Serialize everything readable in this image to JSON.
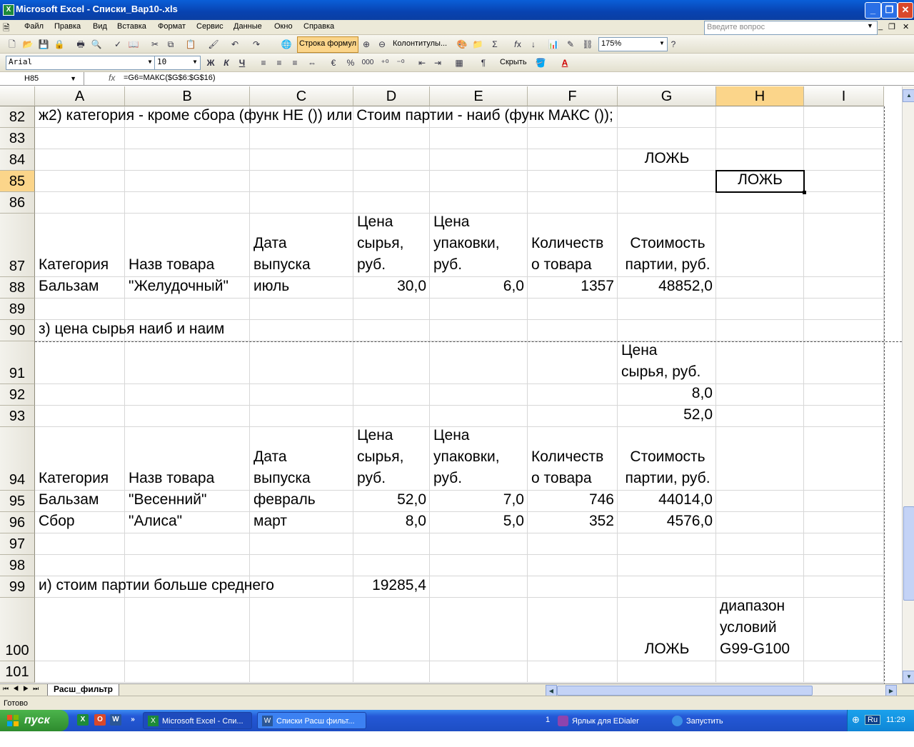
{
  "window": {
    "title": "Microsoft Excel - Списки_Вар10-.xls",
    "help_placeholder": "Введите вопрос"
  },
  "menu": [
    "Файл",
    "Правка",
    "Вид",
    "Вставка",
    "Формат",
    "Сервис",
    "Данные",
    "Окно",
    "Справка"
  ],
  "toolbar": {
    "formula_bar_btn": "Строка формул",
    "headers_footers_btn": "Колонтитулы...",
    "zoom": "175%",
    "font": "Arial",
    "font_size": "10",
    "bold": "Ж",
    "italic": "К",
    "underline": "Ч",
    "percent": "%",
    "thousands": "000",
    "wrap_text": "Скрыть"
  },
  "formula_bar": {
    "name_box": "H85",
    "fx": "fx",
    "formula": "=G6=МАКС($G$6:$G$16)"
  },
  "columns": [
    "A",
    "B",
    "C",
    "D",
    "E",
    "F",
    "G",
    "H",
    "I"
  ],
  "rows": [
    "82",
    "83",
    "84",
    "85",
    "86",
    "87",
    "88",
    "89",
    "90",
    "91",
    "92",
    "93",
    "94",
    "95",
    "96",
    "97",
    "98",
    "99",
    "100",
    "101"
  ],
  "cells": {
    "r82": {
      "A": "ж2) категория - кроме сбора (функ НЕ ()) или Стоим партии - наиб (функ МАКС ());"
    },
    "r84": {
      "G": "ЛОЖЬ"
    },
    "r85": {
      "H": "ЛОЖЬ"
    },
    "r87": {
      "A": "Категория",
      "B": "Назв товара",
      "C": [
        "Дата",
        "выпуска"
      ],
      "D": [
        "Цена",
        "сырья,",
        "руб."
      ],
      "E": [
        "Цена",
        "упаковки,",
        "руб."
      ],
      "F": [
        "Количеств",
        "о товара"
      ],
      "G": [
        "Стоимость",
        "партии, руб."
      ]
    },
    "r88": {
      "A": "Бальзам",
      "B": "\"Желудочный\"",
      "C": "июль",
      "D": "30,0",
      "E": "6,0",
      "F": "1357",
      "G": "48852,0"
    },
    "r90": {
      "A": "з) цена сырья наиб и наим"
    },
    "r91": {
      "G": [
        "Цена",
        "сырья, руб."
      ]
    },
    "r92": {
      "G": "8,0"
    },
    "r93": {
      "G": "52,0"
    },
    "r94": {
      "A": "Категория",
      "B": "Назв товара",
      "C": [
        "Дата",
        "выпуска"
      ],
      "D": [
        "Цена",
        "сырья,",
        "руб."
      ],
      "E": [
        "Цена",
        "упаковки,",
        "руб."
      ],
      "F": [
        "Количеств",
        "о товара"
      ],
      "G": [
        "Стоимость",
        "партии, руб."
      ]
    },
    "r95": {
      "A": "Бальзам",
      "B": "\"Весенний\"",
      "C": "февраль",
      "D": "52,0",
      "E": "7,0",
      "F": "746",
      "G": "44014,0"
    },
    "r96": {
      "A": "Сбор",
      "B": "\"Алиса\"",
      "C": "март",
      "D": "8,0",
      "E": "5,0",
      "F": "352",
      "G": "4576,0"
    },
    "r99": {
      "A": "и) стоим  партии больше среднего",
      "D": "19285,4"
    },
    "r100": {
      "G": "ЛОЖЬ",
      "H": [
        "диапазон",
        "условий",
        "G99-G100"
      ]
    }
  },
  "selected_cell": "H85",
  "sheet_tab": "Расш_фильтр",
  "status": "Готово",
  "taskbar": {
    "start": "пуск",
    "tasks": [
      "Microsoft Excel - Спи...",
      "Списки Расш фильт..."
    ],
    "group_count": "1",
    "tasks_right": [
      "Ярлык для EDialer",
      "Запустить обозревател..."
    ],
    "lang": "Ru",
    "clock": "11:29"
  },
  "colors": {
    "accent": "#fbd58a",
    "title_bar": "#0842b0",
    "taskbar": "#2458d6",
    "start": "#3c9a3c"
  }
}
